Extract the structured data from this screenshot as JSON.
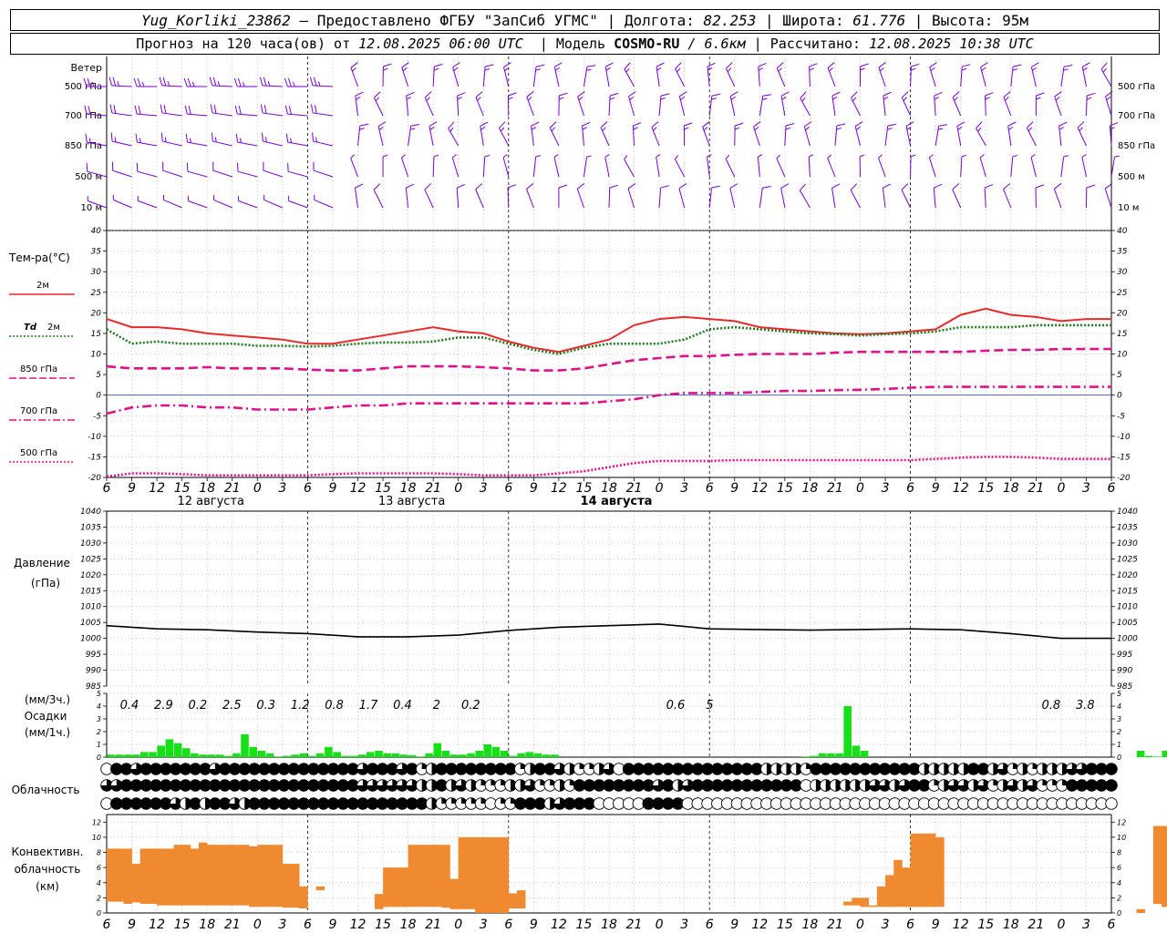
{
  "header": {
    "line1": {
      "station": "Yug_Korliki_23862",
      "sep1": " – ",
      "provided_by": "Предоставлено ФГБУ \"ЗапСиб УГМС\"",
      "lon_label": " | Долгота: ",
      "lon_value": "82.253",
      "lat_label": " | Широта: ",
      "lat_value": "61.776",
      "alt_label": " | Высота: ",
      "alt_value": "95м"
    },
    "line2": {
      "forecast_label": "Прогноз на 120 часа(ов) от ",
      "forecast_from": "12.08.2025 06:00 UTC",
      "model_label": "  | Модель ",
      "model_name": "COSMO-RU",
      "model_res": " / 6.6км",
      "calc_label": " | Рассчитано: ",
      "calc_time": "12.08.2025 10:38 UTC"
    }
  },
  "colors": {
    "wind": "#7a00d0",
    "t2m": "#e82a2a",
    "td2m": "#1f7a1f",
    "t850": "#e0108a",
    "t700": "#e0108a",
    "t500": "#e0108a",
    "precip": "#18e018",
    "convective": "#f08a30",
    "pressure": "#000000",
    "grid": "#888888"
  },
  "chart_data": [
    {
      "type": "wind_barbs",
      "title": "Ветер",
      "levels": [
        "500 гПа",
        "700 гПа",
        "850 гПа",
        "500 м",
        "10 м"
      ],
      "note": "Wind barbs every 3 h at five levels; westerly-to-northwesterly in the first ~24 h, then northerly/northwesterly"
    },
    {
      "type": "line",
      "title": "Тем-ра(°C)",
      "x_hours": [
        0,
        3,
        6,
        9,
        12,
        15,
        18,
        21,
        24,
        27,
        30,
        33,
        36,
        39,
        42,
        45,
        48,
        51,
        54,
        57,
        60,
        63,
        66,
        69,
        72,
        75,
        78,
        81,
        84,
        87,
        90,
        93,
        96,
        99,
        102,
        105,
        108,
        111,
        114,
        117,
        120
      ],
      "x_ticks": [
        "6",
        "9",
        "12",
        "15",
        "18",
        "21",
        "0",
        "3",
        "6",
        "9",
        "12",
        "15",
        "18",
        "21",
        "0",
        "3",
        "6",
        "9",
        "12",
        "15",
        "18",
        "21",
        "0",
        "3",
        "6",
        "9",
        "12",
        "15",
        "18",
        "21",
        "0",
        "3",
        "6",
        "9",
        "12",
        "15",
        "18",
        "21",
        "0",
        "3",
        "6",
        "9",
        "12"
      ],
      "dates": [
        "12 августа",
        "13 августа",
        "14 августа"
      ],
      "ylim": [
        -20,
        40
      ],
      "yticks": [
        -20,
        -15,
        -10,
        -5,
        0,
        5,
        10,
        15,
        20,
        25,
        30,
        35,
        40
      ],
      "series": [
        {
          "name": "2м",
          "style": "solid",
          "values": [
            18.5,
            16.5,
            16.5,
            16.0,
            15.0,
            14.5,
            14.0,
            13.5,
            12.5,
            12.5,
            13.5,
            14.5,
            15.5,
            16.5,
            15.5,
            15.0,
            13.0,
            11.5,
            10.5,
            12.0,
            13.5,
            17.0,
            18.5,
            19.0,
            18.5,
            18.0,
            16.5,
            16.0,
            15.5,
            15.0,
            14.8,
            15.0,
            15.5,
            16.0,
            19.5,
            21.0,
            19.5,
            19.0,
            18.0,
            18.5,
            18.5
          ]
        },
        {
          "name": "Td 2м",
          "style": "dotted",
          "values": [
            16.0,
            12.5,
            13.0,
            12.5,
            12.5,
            12.5,
            12.0,
            12.0,
            11.8,
            12.0,
            12.5,
            12.8,
            12.8,
            13.0,
            14.0,
            14.0,
            12.5,
            11.0,
            10.0,
            11.5,
            12.5,
            12.5,
            12.5,
            13.5,
            16.0,
            16.5,
            16.0,
            15.5,
            15.0,
            14.8,
            14.5,
            14.8,
            15.0,
            15.5,
            16.5,
            16.5,
            16.5,
            17.0,
            17.0,
            17.0,
            17.0
          ]
        },
        {
          "name": "850 гПа",
          "style": "dashed",
          "values": [
            7.0,
            6.5,
            6.5,
            6.5,
            6.8,
            6.5,
            6.5,
            6.5,
            6.2,
            6.0,
            6.0,
            6.5,
            7.0,
            7.0,
            7.0,
            6.8,
            6.5,
            6.0,
            6.0,
            6.5,
            7.5,
            8.5,
            9.0,
            9.5,
            9.5,
            9.8,
            10.0,
            10.0,
            10.0,
            10.3,
            10.5,
            10.5,
            10.5,
            10.5,
            10.5,
            10.8,
            11.0,
            11.0,
            11.2,
            11.2,
            11.2
          ]
        },
        {
          "name": "700 гПа",
          "style": "dashdot",
          "values": [
            -4.5,
            -3.0,
            -2.5,
            -2.5,
            -3.0,
            -3.0,
            -3.5,
            -3.5,
            -3.5,
            -3.0,
            -2.5,
            -2.5,
            -2.0,
            -2.0,
            -2.0,
            -2.0,
            -2.0,
            -2.0,
            -2.0,
            -2.0,
            -1.5,
            -1.0,
            0.0,
            0.5,
            0.5,
            0.5,
            0.8,
            1.0,
            1.0,
            1.2,
            1.3,
            1.5,
            1.8,
            2.0,
            2.0,
            2.0,
            2.0,
            2.0,
            2.0,
            2.0,
            2.0
          ]
        },
        {
          "name": "500 гПа",
          "style": "dotted",
          "values": [
            -19.8,
            -19.0,
            -19.0,
            -19.2,
            -19.5,
            -19.5,
            -19.5,
            -19.5,
            -19.5,
            -19.2,
            -19.0,
            -19.0,
            -19.0,
            -19.0,
            -19.2,
            -19.5,
            -19.5,
            -19.5,
            -19.0,
            -18.5,
            -17.5,
            -16.5,
            -16.0,
            -16.0,
            -16.0,
            -15.8,
            -15.8,
            -15.8,
            -15.8,
            -15.8,
            -15.8,
            -15.8,
            -15.8,
            -15.5,
            -15.2,
            -15.0,
            -15.0,
            -15.2,
            -15.5,
            -15.5,
            -15.5
          ]
        }
      ]
    },
    {
      "type": "line",
      "title": "Давление",
      "ylabel": "(гПа)",
      "ylim": [
        985,
        1040
      ],
      "yticks": [
        985,
        990,
        995,
        1000,
        1005,
        1010,
        1015,
        1020,
        1025,
        1030,
        1035,
        1040
      ],
      "x_hours": [
        0,
        6,
        12,
        18,
        24,
        30,
        36,
        42,
        48,
        54,
        60,
        66,
        72,
        78,
        84,
        90,
        96,
        102,
        108,
        114,
        120
      ],
      "values": [
        1004.0,
        1003.0,
        1002.7,
        1002.0,
        1001.5,
        1000.5,
        1000.5,
        1001.0,
        1002.5,
        1003.5,
        1004.0,
        1004.5,
        1003.0,
        1002.8,
        1002.6,
        1002.8,
        1003.0,
        1002.7,
        1001.5,
        1000.0,
        1000.0
      ]
    },
    {
      "type": "bar",
      "title": "Осадки",
      "ylabel_3h": "(мм/3ч.)",
      "ylabel_1h": "(мм/1ч.)",
      "ylim": [
        0,
        5
      ],
      "yticks": [
        0,
        1,
        2,
        3,
        4,
        5
      ],
      "hourly_values": [
        0.2,
        0.2,
        0.2,
        0.2,
        0.4,
        0.4,
        0.9,
        1.4,
        1.1,
        0.7,
        0.3,
        0.2,
        0.2,
        0.2,
        0.1,
        0.3,
        1.8,
        0.8,
        0.5,
        0.3,
        0.05,
        0.1,
        0.2,
        0.3,
        0.1,
        0.3,
        0.8,
        0.4,
        0.1,
        0.1,
        0.2,
        0.4,
        0.5,
        0.3,
        0.3,
        0.2,
        0.15,
        0.05,
        0.3,
        1.1,
        0.5,
        0.2,
        0.2,
        0.3,
        0.5,
        1.0,
        0.8,
        0.5,
        0.1,
        0.3,
        0.4,
        0.3,
        0.2,
        0.2,
        0,
        0,
        0,
        0,
        0,
        0,
        0,
        0,
        0,
        0,
        0,
        0,
        0,
        0,
        0,
        0,
        0,
        0,
        0,
        0,
        0,
        0,
        0,
        0,
        0,
        0,
        0,
        0,
        0,
        0.05,
        0.1,
        0.3,
        0.3,
        0.3,
        4.0,
        0.9,
        0.5,
        0,
        0,
        0,
        0,
        0,
        0,
        0,
        0,
        0,
        0,
        0,
        0,
        0,
        0,
        0,
        0,
        0,
        0,
        0,
        0,
        0,
        0,
        0,
        0,
        0,
        0,
        0,
        0,
        0,
        0,
        0,
        0,
        0.5,
        0.1,
        0.05,
        0.5,
        0.2,
        3.0,
        1.0,
        0.8
      ],
      "sums_3h": [
        {
          "x": 2,
          "label": "0.4"
        },
        {
          "x": 5,
          "label": "2.9"
        },
        {
          "x": 8,
          "label": "0.2"
        },
        {
          "x": 11,
          "label": "2.5"
        },
        {
          "x": 14,
          "label": "0.3"
        },
        {
          "x": 17,
          "label": "1.2"
        },
        {
          "x": 20,
          "label": "0.8"
        },
        {
          "x": 23,
          "label": "1.7"
        },
        {
          "x": 26,
          "label": "0.4"
        },
        {
          "x": 29,
          "label": "2"
        },
        {
          "x": 32,
          "label": "0.2"
        },
        {
          "x": 50,
          "label": "0.6"
        },
        {
          "x": 53,
          "label": "5"
        },
        {
          "x": 83,
          "label": "0.8"
        },
        {
          "x": 86,
          "label": "3.8"
        }
      ]
    },
    {
      "type": "table",
      "title": "Облачность",
      "rows": [
        "0443444444434444444444444434443412444444441244321123044444444444444222214444444444422222442312122233444",
        "3344444444444444444444444433333322423211122311214444444434234444444444402222223323441233231232311144444",
        "0444444324244324444444444444444442111110114442344400000444400000000000000000000000000000000000000000000"
      ],
      "legend": "0 = clear, 1 = 1/4, 2 = 1/2, 3 = 3/4, 4 = overcast"
    },
    {
      "type": "bar",
      "title": "Конвективн. облачность",
      "ylabel": "(км)",
      "ylim": [
        0,
        13
      ],
      "yticks": [
        0,
        2,
        4,
        6,
        8,
        10,
        12
      ],
      "x_hours": [
        0,
        1,
        2,
        3,
        4,
        5,
        6,
        7,
        8,
        9,
        10,
        11,
        12,
        13,
        14,
        15,
        16,
        17,
        18,
        19,
        20,
        21,
        22,
        23,
        24,
        25,
        26,
        27,
        28,
        29,
        30,
        31,
        32,
        33,
        34,
        35,
        36,
        37,
        38,
        39,
        40,
        41,
        42,
        43,
        44,
        45,
        46,
        47,
        48,
        49,
        50,
        51,
        52,
        53,
        54,
        55,
        56,
        57,
        58,
        59,
        60,
        61,
        62,
        63,
        64,
        65,
        66,
        67,
        68,
        69,
        70,
        71,
        72,
        73,
        74,
        75,
        76,
        77,
        78,
        79,
        80,
        81,
        82,
        83,
        84,
        85,
        86,
        87,
        88,
        89,
        90,
        91,
        92,
        93,
        94,
        95,
        96,
        97,
        98,
        99,
        100,
        101,
        102,
        103,
        104,
        105,
        106,
        107,
        108,
        109,
        110,
        111,
        112,
        113,
        114,
        115,
        116,
        117,
        118,
        119,
        120
      ],
      "bases": [
        1.5,
        1.5,
        1.2,
        1.4,
        1.2,
        1.2,
        1.0,
        1.0,
        1.0,
        1.0,
        1.0,
        1.0,
        1.0,
        1.0,
        1.0,
        1.0,
        1.0,
        0.8,
        0.8,
        0.8,
        0.8,
        0.7,
        0.7,
        0.6,
        0,
        3.0,
        0,
        0,
        0,
        0.2,
        0.2,
        0.2,
        0.5,
        0.8,
        0.8,
        0.8,
        0.8,
        0.8,
        0.8,
        0.8,
        0.7,
        0.5,
        0.5,
        0.5,
        0,
        0,
        0,
        0,
        0.6,
        0.6,
        0,
        0,
        0,
        0,
        0,
        0,
        0,
        0,
        0,
        0,
        0,
        0,
        0,
        0,
        0,
        0,
        0,
        0,
        0,
        0,
        0,
        0,
        0,
        0,
        0,
        0,
        0,
        0,
        0,
        0,
        0,
        0,
        0,
        0,
        0,
        0,
        0,
        0,
        1.0,
        1.0,
        0.8,
        0.8,
        0.8,
        0.8,
        0.8,
        0.8,
        0.8,
        0.8,
        0.8,
        0.8,
        0,
        0,
        0,
        0,
        0,
        0,
        0,
        0,
        0,
        0,
        0,
        0,
        0,
        0,
        0,
        0,
        0,
        0,
        0,
        0,
        0,
        0,
        0,
        0,
        0.5,
        1.2,
        0.8,
        0.8,
        0.8
      ],
      "tops": [
        8.5,
        8.5,
        8.5,
        6.5,
        8.5,
        8.5,
        8.5,
        8.5,
        9.0,
        9.0,
        8.5,
        9.3,
        9.0,
        9.0,
        9.0,
        9.0,
        9.0,
        8.8,
        9.0,
        9.0,
        9.0,
        6.5,
        6.5,
        3.5,
        0,
        3.5,
        0,
        0,
        0,
        0.2,
        0.2,
        0.2,
        2.5,
        6.0,
        6.0,
        6.0,
        9.0,
        9.0,
        9.0,
        9.0,
        9.0,
        4.5,
        10.0,
        10.0,
        10.0,
        10.0,
        10.0,
        10.0,
        2.6,
        3.0,
        0,
        0,
        0,
        0,
        0,
        0,
        0,
        0,
        0,
        0,
        0,
        0,
        0,
        0,
        0,
        0,
        0,
        0,
        0,
        0,
        0,
        0,
        0,
        0,
        0,
        0,
        0,
        0,
        0,
        0,
        0,
        0,
        0,
        0,
        0,
        0,
        0,
        0,
        1.5,
        2.0,
        2.0,
        1.0,
        3.5,
        5.0,
        7.0,
        6.0,
        10.5,
        10.5,
        10.5,
        10.0,
        0,
        0,
        0,
        0,
        0,
        0,
        0,
        0,
        0,
        0,
        0,
        0,
        0,
        0,
        0,
        0,
        0,
        0,
        0,
        0,
        0,
        0,
        0,
        0.5,
        0.5,
        11.5,
        11.5,
        2.0,
        2.0,
        10.5,
        11.5,
        11.0,
        10.0,
        9.8
      ]
    }
  ],
  "labels": {
    "wind": "Ветер",
    "wind_levels": [
      "500 гПа",
      "700 гПа",
      "850 гПа",
      "500 м",
      "10 м"
    ],
    "temp_title": "Тем-ра(°C)",
    "legend_2m": "2м",
    "legend_td_prefix": "Td",
    "legend_td": "2м",
    "legend_850": "850 гПа",
    "legend_700": "700 гПа",
    "legend_500": "500 гПа",
    "pressure": "Давление",
    "pressure_unit": "(гПа)",
    "precip_3h": "(мм/3ч.)",
    "precip": "Осадки",
    "precip_1h": "(мм/1ч.)",
    "cloud": "Облачность",
    "conv1": "Конвективн.",
    "conv2": "облачность",
    "conv3": "(км)"
  }
}
